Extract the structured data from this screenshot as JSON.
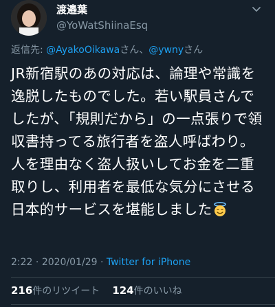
{
  "author": {
    "display_name": "渡邉葉",
    "handle": "@YoWatShiinaEsq"
  },
  "reply": {
    "prefix": "返信先: ",
    "mention1": "@AyakoOikawa",
    "mention1_suffix": "さん、",
    "mention2": "@ywny",
    "mention2_suffix": "さん"
  },
  "tweet": {
    "text": "JR新宿駅のあの対応は、論理や常識を逸脱したものでした。若い駅員さんでしたが、「規則だから」の一点張りで領収書持ってる旅行者を盗人呼ばわり。人を理由なく盗人扱いしてお金を二重取りし、利用者を最低な気分にさせる日本的サービスを堪能しました",
    "emoji": "smiling-face-with-halo"
  },
  "meta": {
    "time": "2:22",
    "separator": " · ",
    "date": "2020/01/29",
    "separator2": " · ",
    "source": "Twitter for iPhone"
  },
  "stats": {
    "retweets_count": "216",
    "retweets_label": "件のリツイート",
    "likes_count": "124",
    "likes_label": "件のいいね"
  },
  "colors": {
    "background": "#15202b",
    "accent": "#1da1f2",
    "secondary_text": "#8899a6"
  },
  "icons": {
    "more": "chevron-down-icon",
    "emoji": "halo-emoji-icon"
  }
}
